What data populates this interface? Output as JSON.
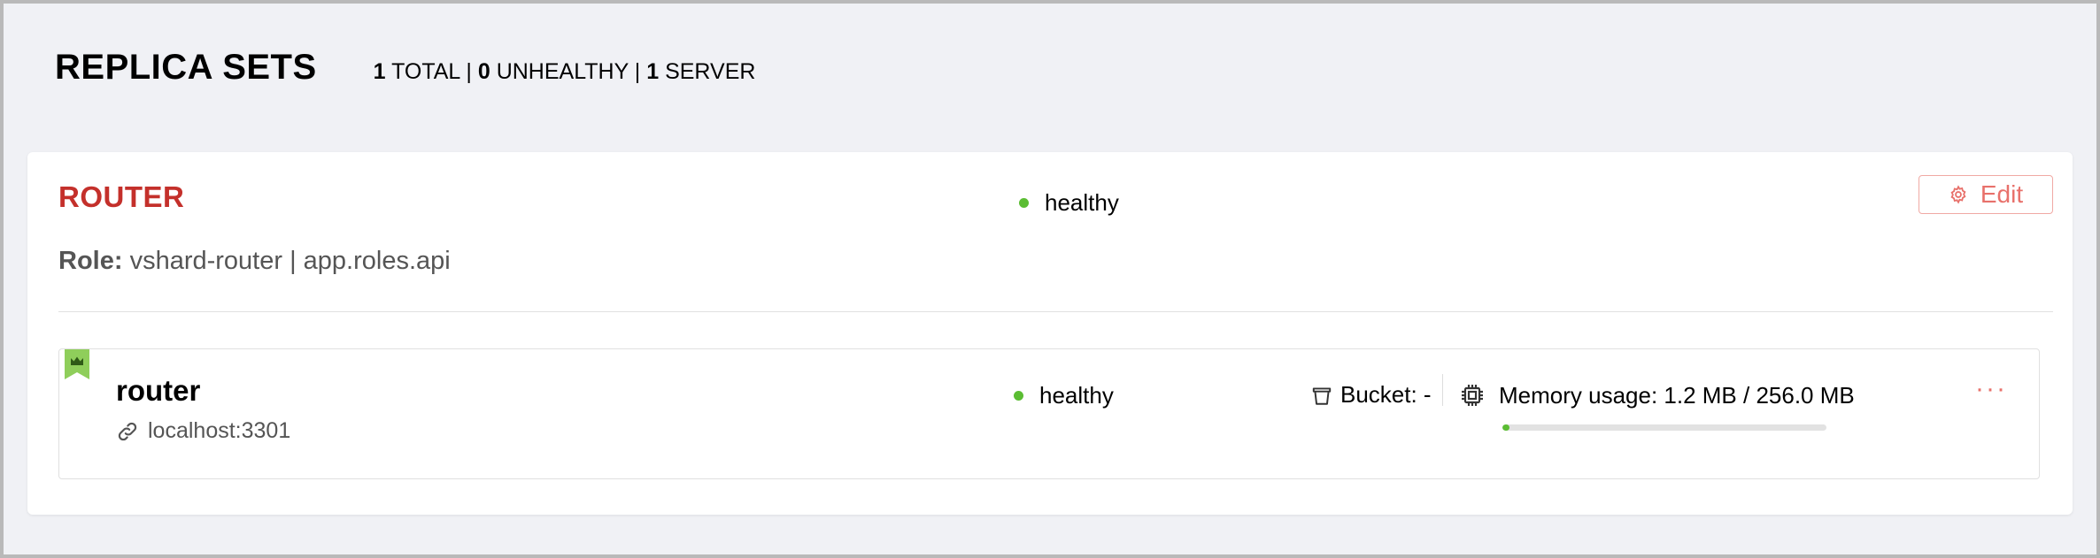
{
  "header": {
    "title": "REPLICA SETS",
    "total_count": "1",
    "total_label": "TOTAL",
    "unhealthy_count": "0",
    "unhealthy_label": "UNHEALTHY",
    "server_count": "1",
    "server_label": "SERVER",
    "separator": "|"
  },
  "replicaset": {
    "name": "ROUTER",
    "status": "healthy",
    "edit_label": "Edit",
    "role_key": "Role:",
    "role_value": "vshard-router | app.roles.api"
  },
  "server": {
    "name": "router",
    "uri": "localhost:3301",
    "status": "healthy",
    "bucket_label": "Bucket: -",
    "memory_label": "Memory usage: 1.2 MB / 256.0 MB",
    "memory_fraction": 0.005,
    "more_label": "···"
  },
  "colors": {
    "accent": "#c4302b",
    "healthy": "#5bbd33",
    "leader_flag": "#8fce5b",
    "button": "#e8716b"
  },
  "icons": {
    "leader": "crown-flag-icon",
    "edit": "gear-icon",
    "uri": "link-icon",
    "bucket": "bucket-icon",
    "memory": "chip-icon",
    "more": "more-icon"
  }
}
